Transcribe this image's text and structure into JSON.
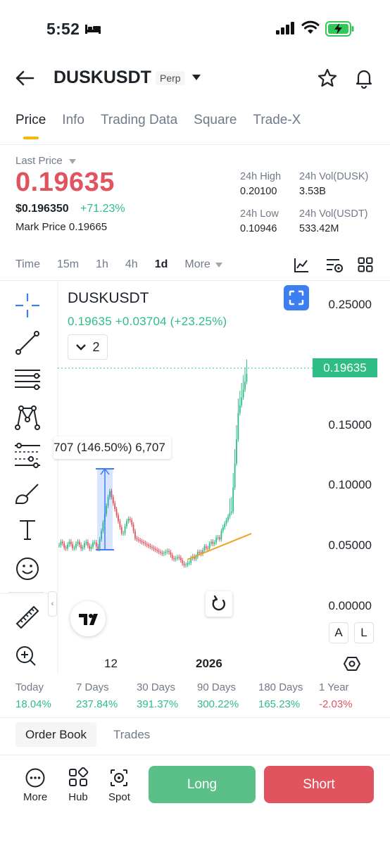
{
  "status_bar": {
    "time": "5:52"
  },
  "header": {
    "pair": "DUSKUSDT",
    "badge": "Perp"
  },
  "tabs": [
    {
      "label": "Price"
    },
    {
      "label": "Info"
    },
    {
      "label": "Trading Data"
    },
    {
      "label": "Square"
    },
    {
      "label": "Trade-X"
    }
  ],
  "price": {
    "last_label": "Last Price",
    "last": "0.19635",
    "usd": "$0.196350",
    "change_pct": "+71.23%",
    "mark_label": "Mark Price",
    "mark": "0.19665"
  },
  "stats": {
    "high_label": "24h High",
    "high": "0.20100",
    "vol_base_label": "24h Vol(DUSK)",
    "vol_base": "3.53B",
    "low_label": "24h Low",
    "low": "0.10946",
    "vol_quote_label": "24h Vol(USDT)",
    "vol_quote": "533.42M"
  },
  "intervals": [
    "Time",
    "15m",
    "1h",
    "4h",
    "1d",
    "More"
  ],
  "chart": {
    "symbol": "DUSKUSDT",
    "ohlc": "0.19635 +0.03704 (+23.25%)",
    "indicator_count": "2",
    "price_tag": "0.19635",
    "measure_text": "707 (146.50%) 6,707",
    "scale_a": "A",
    "scale_l": "L"
  },
  "chart_data": {
    "type": "candlestick",
    "y_ticks": [
      "0.25000",
      "0.15000",
      "0.10000",
      "0.05000",
      "0.00000"
    ],
    "x_ticks": [
      "12",
      "2026"
    ],
    "last_price": 0.19635,
    "up_color": "#2ebd85",
    "down_color": "#e0535f"
  },
  "performance": [
    {
      "label": "Today",
      "value": "18.04%",
      "dir": "pos"
    },
    {
      "label": "7 Days",
      "value": "237.84%",
      "dir": "pos"
    },
    {
      "label": "30 Days",
      "value": "391.37%",
      "dir": "pos"
    },
    {
      "label": "90 Days",
      "value": "300.22%",
      "dir": "pos"
    },
    {
      "label": "180 Days",
      "value": "165.23%",
      "dir": "pos"
    },
    {
      "label": "1 Year",
      "value": "-2.03%",
      "dir": "neg"
    }
  ],
  "bottom_tabs": {
    "order_book": "Order Book",
    "trades": "Trades"
  },
  "bottom_bar": {
    "more": "More",
    "hub": "Hub",
    "spot": "Spot",
    "long": "Long",
    "short": "Short"
  }
}
